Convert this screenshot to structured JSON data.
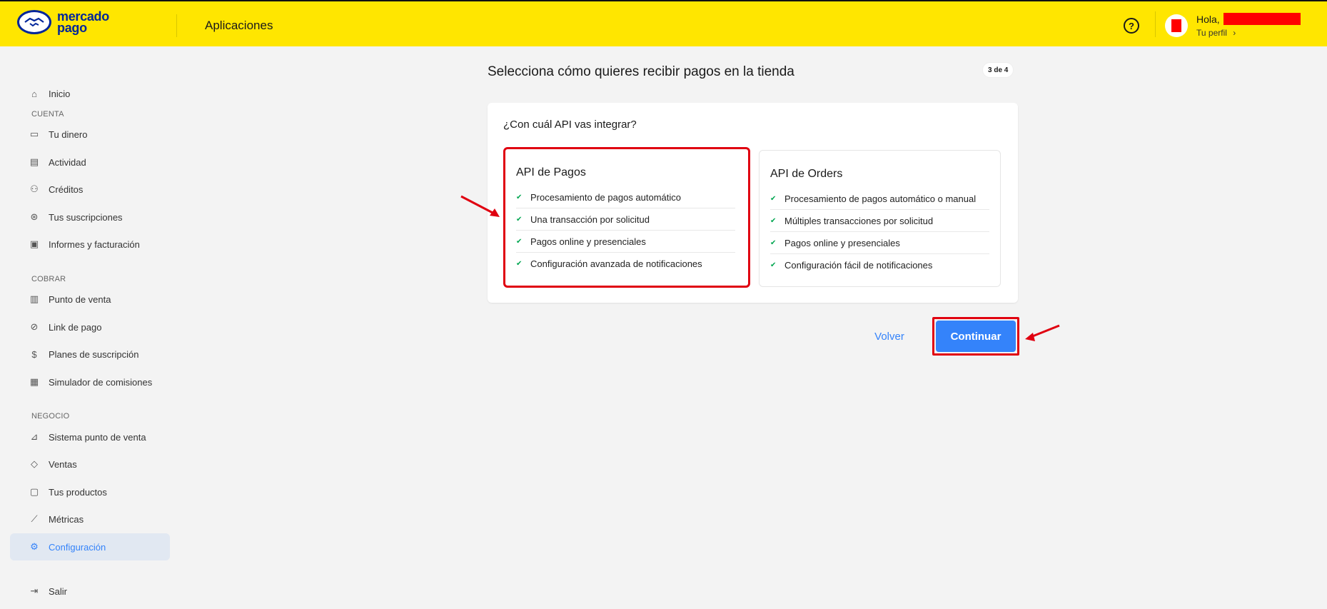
{
  "header": {
    "brand_line1": "mercado",
    "brand_line2": "pago",
    "title": "Aplicaciones",
    "greeting": "Hola,",
    "profile_link": "Tu perfil",
    "profile_chevron": "›",
    "help_icon": "help-circle-icon",
    "background_color": "#ffe600",
    "brand_color": "#00259a"
  },
  "sidebar": {
    "items": [
      {
        "label": "Inicio",
        "icon": "home-icon"
      },
      {
        "label": "Tu dinero",
        "icon": "wallet-icon"
      },
      {
        "label": "Actividad",
        "icon": "activity-icon"
      },
      {
        "label": "Créditos",
        "icon": "credits-icon"
      },
      {
        "label": "Tus suscripciones",
        "icon": "subscriptions-icon"
      },
      {
        "label": "Informes y facturación",
        "icon": "reports-icon"
      },
      {
        "label": "Punto de venta",
        "icon": "point-of-sale-icon"
      },
      {
        "label": "Link de pago",
        "icon": "payment-link-icon"
      },
      {
        "label": "Planes de suscripción",
        "icon": "subscription-plans-icon"
      },
      {
        "label": "Simulador de comisiones",
        "icon": "calculator-icon"
      },
      {
        "label": "Sistema punto de venta",
        "icon": "pos-system-icon"
      },
      {
        "label": "Ventas",
        "icon": "tag-icon"
      },
      {
        "label": "Tus productos",
        "icon": "products-icon"
      },
      {
        "label": "Métricas",
        "icon": "metrics-icon"
      },
      {
        "label": "Configuración",
        "icon": "settings-icon",
        "active": true
      },
      {
        "label": "Salir",
        "icon": "logout-icon"
      }
    ],
    "sections": [
      "CUENTA",
      "COBRAR",
      "NEGOCIO"
    ]
  },
  "main": {
    "title": "Selecciona cómo quieres recibir pagos en la tienda",
    "step": "3 de 4",
    "question": "¿Con cuál API vas integrar?",
    "options": [
      {
        "title": "API de Pagos",
        "selected": true,
        "features": [
          "Procesamiento de pagos automático",
          "Una transacción por solicitud",
          "Pagos online y presenciales",
          "Configuración avanzada de notificaciones"
        ]
      },
      {
        "title": "API de Orders",
        "selected": false,
        "features": [
          "Procesamiento de pagos automático o manual",
          "Múltiples transacciones por solicitud",
          "Pagos online y presenciales",
          "Configuración fácil de notificaciones"
        ]
      }
    ],
    "back_label": "Volver",
    "continue_label": "Continuar",
    "accent_color": "#3483fa",
    "highlight_color": "#e00010",
    "check_color": "#00a650"
  }
}
